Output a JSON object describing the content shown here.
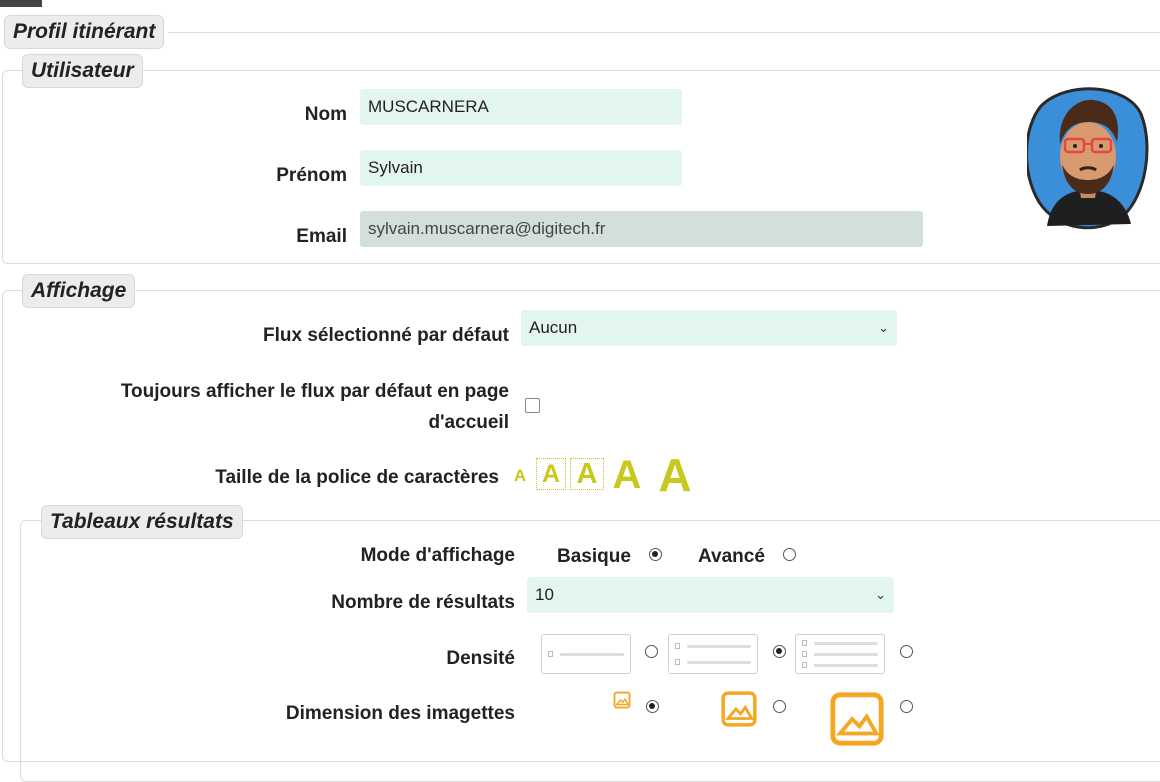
{
  "sections": {
    "profile_title": "Profil itinérant",
    "user_title": "Utilisateur",
    "display_title": "Affichage",
    "results_title": "Tableaux résultats"
  },
  "user": {
    "nom_label": "Nom",
    "nom_value": "MUSCARNERA",
    "prenom_label": "Prénom",
    "prenom_value": "Sylvain",
    "email_label": "Email",
    "email_value": "sylvain.muscarnera@digitech.fr"
  },
  "display": {
    "flux_label": "Flux sélectionné par défaut",
    "flux_value": "Aucun",
    "always_show_label_line1": "Toujours afficher le flux par défaut en page",
    "always_show_label_line2": "d'accueil",
    "always_show_checked": false,
    "font_size_label": "Taille de la police de caractères",
    "font_size_glyph": "A",
    "font_sizes_count": 5
  },
  "results": {
    "mode_label": "Mode d'affichage",
    "mode_basic": "Basique",
    "mode_advanced": "Avancé",
    "mode_selected": "Basique",
    "count_label": "Nombre de résultats",
    "count_value": "10",
    "density_label": "Densité",
    "density_selected_index": 1,
    "thumb_label": "Dimension des imagettes",
    "thumb_selected_index": 0
  },
  "colors": {
    "input_bg": "#e2f5ee",
    "input_disabled_bg": "#d3e0da",
    "font_size_accent": "#c8c81e",
    "thumbnail_accent": "#f5a623",
    "avatar_bg": "#3b8fd9"
  },
  "icons": {
    "select_arrow": "chevron-down-icon",
    "thumbnail": "image-icon",
    "avatar": "user-avatar"
  }
}
